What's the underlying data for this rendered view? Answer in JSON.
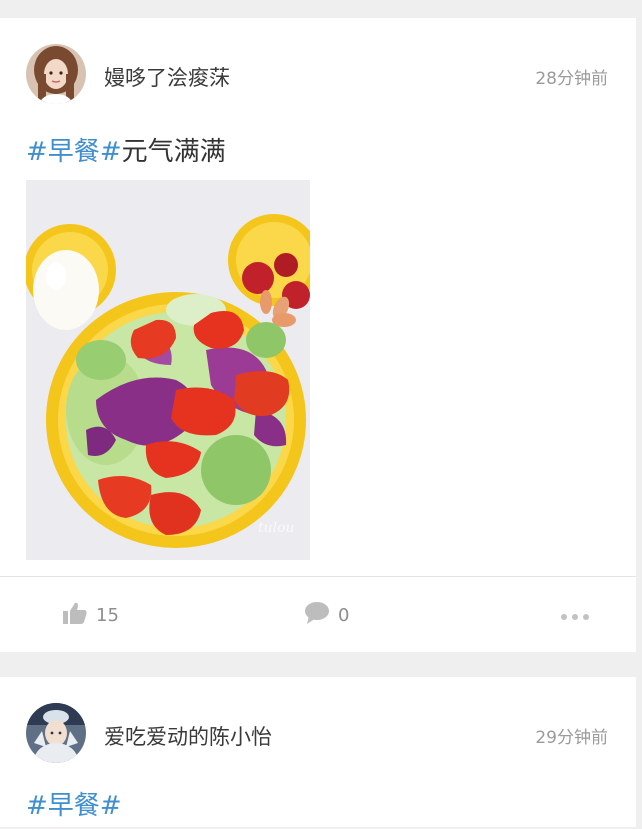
{
  "posts": [
    {
      "username": "嫚哆了浍痠莯",
      "time": "28分钟前",
      "text": {
        "tag_open": "#",
        "tag": "早餐",
        "tag_close": "#",
        "body": "元气满满"
      },
      "image": "salad-plate-photo",
      "likes": "15",
      "comments": "0",
      "like_icon": "thumbs-up-icon",
      "comment_icon": "speech-bubble-icon",
      "more_icon": "more-dots-icon"
    },
    {
      "username": "爱吃爱动的陈小怡",
      "time": "29分钟前",
      "text": {
        "tag_open": "#",
        "tag": "早餐",
        "tag_close": "#",
        "body": ""
      }
    }
  ],
  "colors": {
    "background": "#efefef",
    "card": "#ffffff",
    "hashtag": "#3f8fcf",
    "meta": "#9b9b9b"
  }
}
